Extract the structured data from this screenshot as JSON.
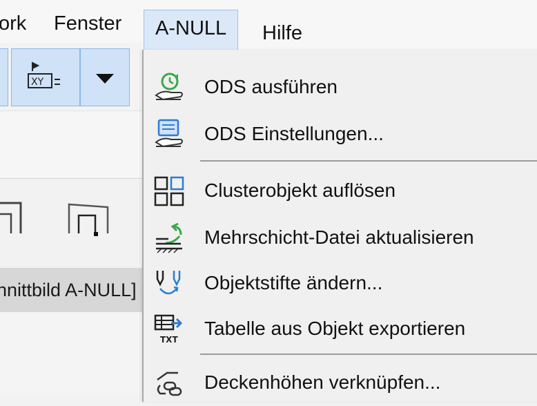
{
  "menubar": {
    "items": [
      {
        "label": "ork"
      },
      {
        "label": "Fenster"
      },
      {
        "label": "A-NULL"
      },
      {
        "label": "Hilfe"
      }
    ]
  },
  "left_panel": {
    "status_label": "[Schnittbild A-NULL]"
  },
  "dropdown": {
    "items": [
      {
        "label": "ODS ausführen",
        "icon": "ods-run-icon"
      },
      {
        "label": "ODS Einstellungen...",
        "icon": "ods-settings-icon"
      },
      {
        "label": "Clusterobjekt auflösen",
        "icon": "cluster-grid-icon"
      },
      {
        "label": "Mehrschicht-Datei aktualisieren",
        "icon": "layer-refresh-icon"
      },
      {
        "label": "Objektstifte ändern...",
        "icon": "pen-change-icon"
      },
      {
        "label": "Tabelle aus Objekt exportieren",
        "icon": "table-export-txt-icon"
      },
      {
        "label": "Deckenhöhen verknüpfen...",
        "icon": "link-chain-icon"
      }
    ]
  },
  "colors": {
    "accent": "#2b7bd6",
    "accent_green": "#3aa84a",
    "menu_bg": "#f0f0f0",
    "active_menu_bg": "#dbe8f7"
  }
}
